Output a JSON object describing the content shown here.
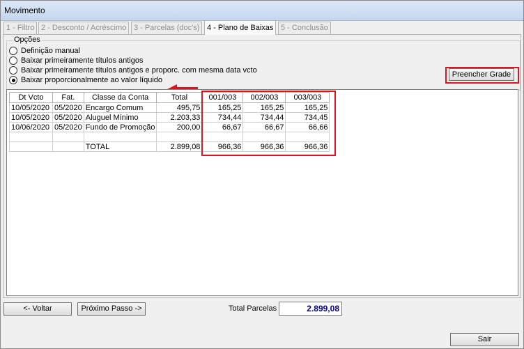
{
  "window": {
    "title": "Movimento"
  },
  "tabs": [
    {
      "label": "1 - Filtro",
      "active": false
    },
    {
      "label": "2 - Desconto / Acréscimo",
      "active": false
    },
    {
      "label": "3 - Parcelas (doc's)",
      "active": false
    },
    {
      "label": "4 - Plano de Baixas",
      "active": true
    },
    {
      "label": "5 - Conclusão",
      "active": false
    }
  ],
  "options": {
    "legend": "Opções",
    "items": [
      {
        "label": "Definição manual",
        "checked": false
      },
      {
        "label": "Baixar primeiramente títulos antigos",
        "checked": false
      },
      {
        "label": "Baixar primeiramente títulos antigos e proporc. com mesma data vcto",
        "checked": false
      },
      {
        "label": "Baixar proporcionalmente ao valor líquido",
        "checked": true
      }
    ],
    "fill_button": "Preencher Grade"
  },
  "grid": {
    "headers": [
      "Dt Vcto",
      "Fat.",
      "Classe da Conta",
      "Total",
      "001/003",
      "002/003",
      "003/003"
    ],
    "rows": [
      [
        "10/05/2020",
        "05/2020",
        "Encargo Comum",
        "495,75",
        "165,25",
        "165,25",
        "165,25"
      ],
      [
        "10/05/2020",
        "05/2020",
        "Aluguel Mínimo",
        "2.203,33",
        "734,44",
        "734,44",
        "734,45"
      ],
      [
        "10/06/2020",
        "05/2020",
        "Fundo de Promoção",
        "200,00",
        "66,67",
        "66,67",
        "66,66"
      ],
      [
        "",
        "",
        "",
        "",
        "",
        "",
        ""
      ]
    ],
    "total_row": [
      "",
      "",
      "TOTAL",
      "2.899,08",
      "966,36",
      "966,36",
      "966,36"
    ]
  },
  "footer": {
    "back_button": "<- Voltar",
    "next_button": "Próximo Passo ->",
    "total_label": "Total Parcelas",
    "total_value": "2.899,08",
    "exit_button": "Sair"
  },
  "colors": {
    "highlight": "#e0141e",
    "total_value": "#00008b"
  }
}
